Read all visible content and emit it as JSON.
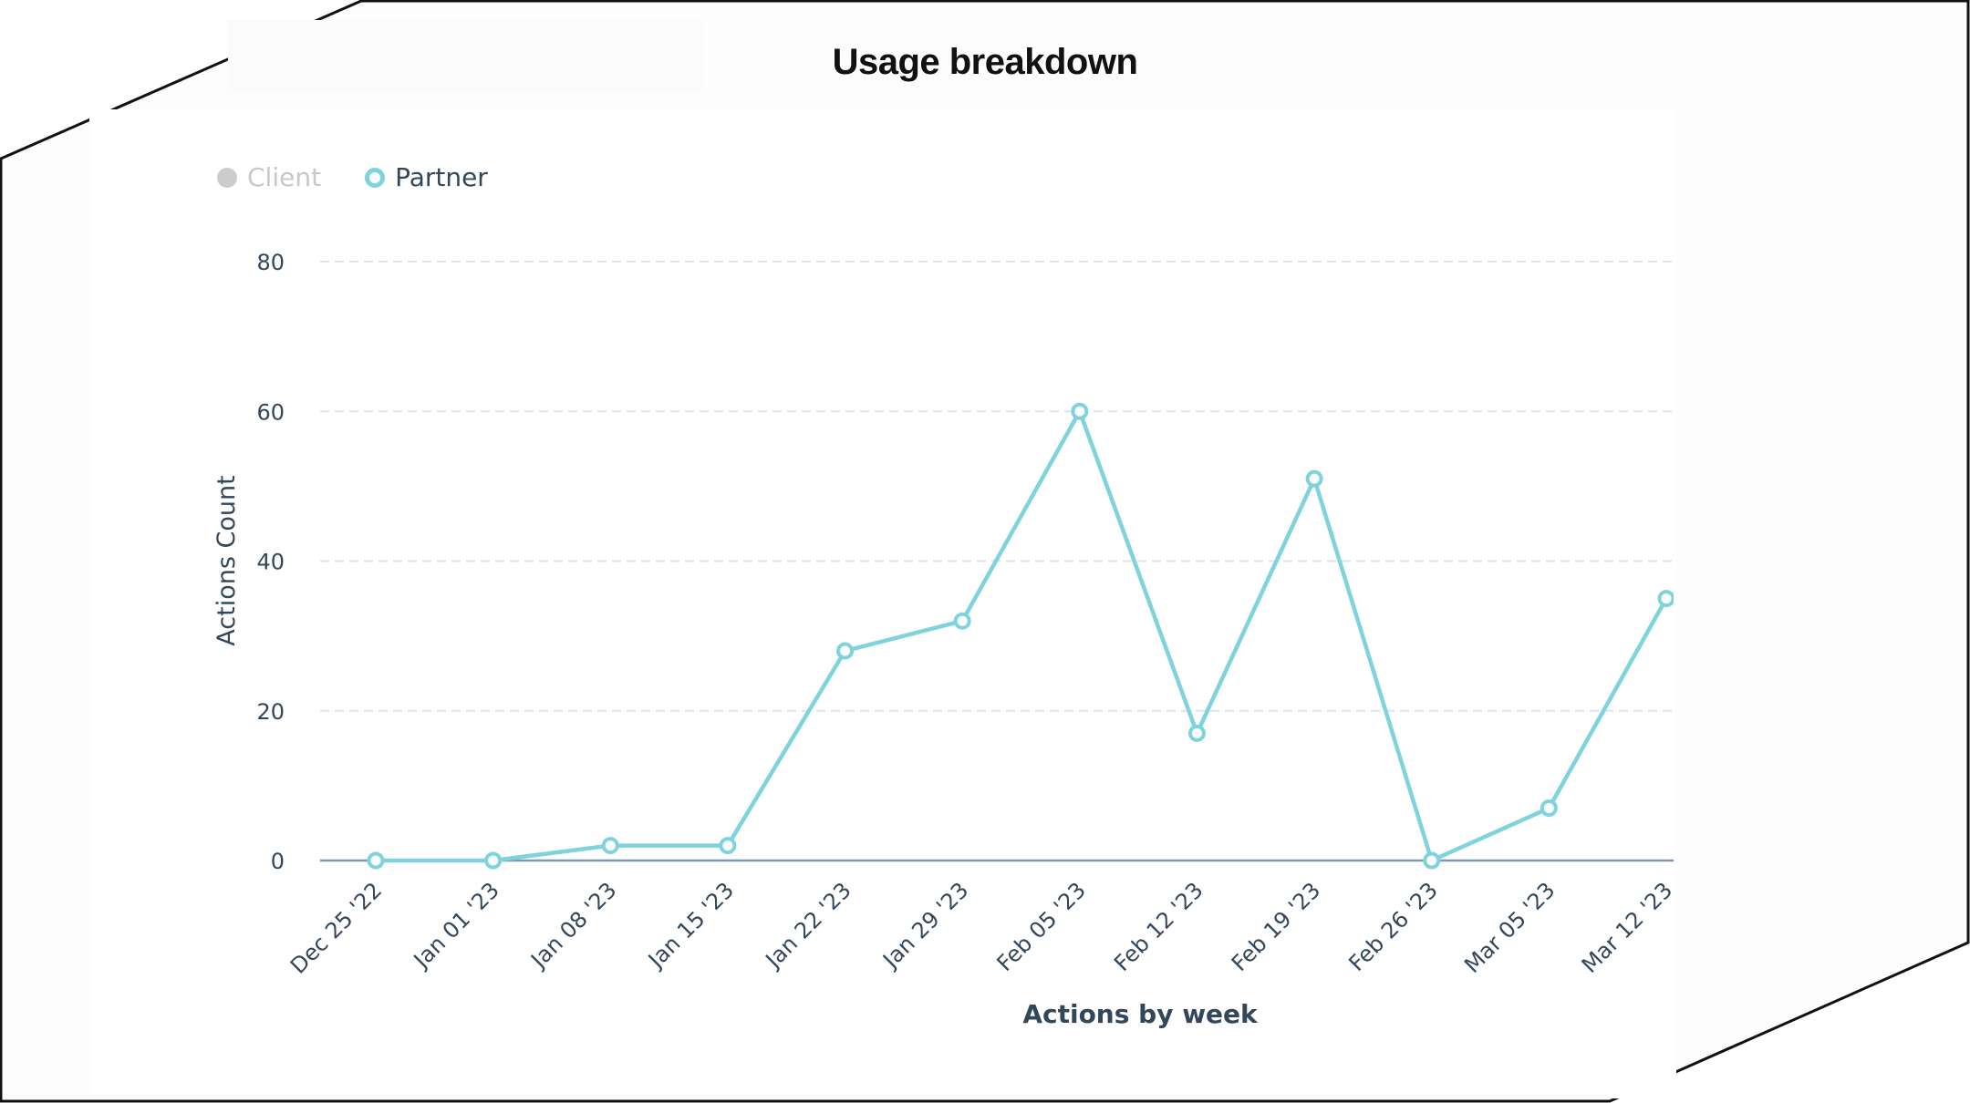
{
  "title": "Usage breakdown",
  "legend": {
    "items": [
      {
        "label": "Client",
        "state": "hidden",
        "color": "#cccccc",
        "marker": "filled-circle-icon"
      },
      {
        "label": "Partner",
        "state": "visible",
        "color": "#7fd3dc",
        "marker": "ring-icon"
      }
    ]
  },
  "colors": {
    "series": "#7fd3dc",
    "axis_text": "#33475b",
    "gridline": "#dfe3eb",
    "baseline": "#7c98b6",
    "title": "#111111",
    "legend_hidden": "#cccccc"
  },
  "chart_data": {
    "type": "line",
    "title": "Usage breakdown",
    "xlabel": "Actions by week",
    "ylabel": "Actions Count",
    "categories": [
      "Dec 25 '22",
      "Jan 01 '23",
      "Jan 08 '23",
      "Jan 15 '23",
      "Jan 22 '23",
      "Jan 29 '23",
      "Feb 05 '23",
      "Feb 12 '23",
      "Feb 19 '23",
      "Feb 26 '23",
      "Mar 05 '23",
      "Mar 12 '23"
    ],
    "series": [
      {
        "name": "Client",
        "visible": false,
        "values": []
      },
      {
        "name": "Partner",
        "visible": true,
        "values": [
          0,
          0,
          2,
          2,
          28,
          32,
          60,
          17,
          51,
          0,
          7,
          35
        ]
      }
    ],
    "yticks": [
      0,
      20,
      40,
      60,
      80
    ],
    "ylim": [
      0,
      80
    ],
    "grid": true,
    "legend_position": "top-left"
  }
}
